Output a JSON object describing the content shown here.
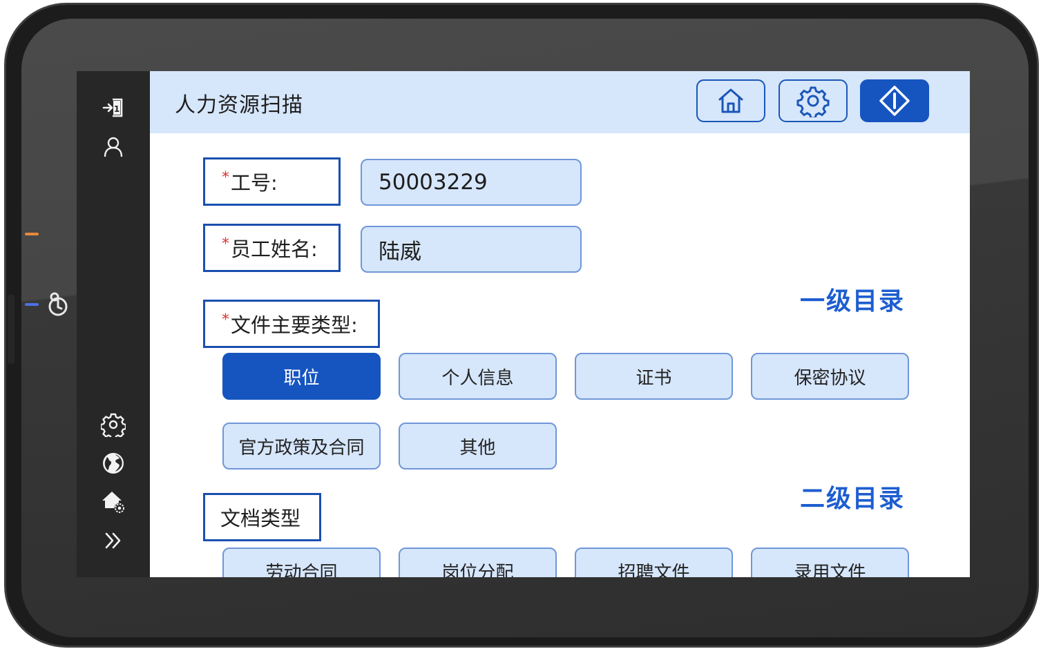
{
  "header": {
    "title": "人力资源扫描"
  },
  "form": {
    "employee_id_label": "工号:",
    "employee_id_value": "50003229",
    "employee_name_label": "员工姓名:",
    "employee_name_value": "陆威",
    "required_mark": "*"
  },
  "primary_category": {
    "section_title": "一级目录",
    "label": "文件主要类型:",
    "options": [
      "职位",
      "个人信息",
      "证书",
      "保密协议",
      "官方政策及合同",
      "其他"
    ],
    "selected": "职位"
  },
  "secondary_category": {
    "section_title": "二级目录",
    "label": "文档类型",
    "options": [
      "劳动合同",
      "岗位分配",
      "招聘文件",
      "录用文件"
    ]
  },
  "icons": {
    "sidebar": [
      "sign-in-icon",
      "user-icon",
      "settings-icon",
      "globe-icon",
      "home-settings-icon",
      "double-chevron-right-icon"
    ],
    "header": [
      "home-icon",
      "gear-icon",
      "start-icon"
    ],
    "device": "key-logo-icon"
  },
  "colors": {
    "accent": "#1655c0",
    "header_bg": "#d6e6fb",
    "section_title": "#1d5ed0",
    "required": "#e03030",
    "led_orange": "#e78a3c",
    "led_blue": "#4a72e6"
  }
}
